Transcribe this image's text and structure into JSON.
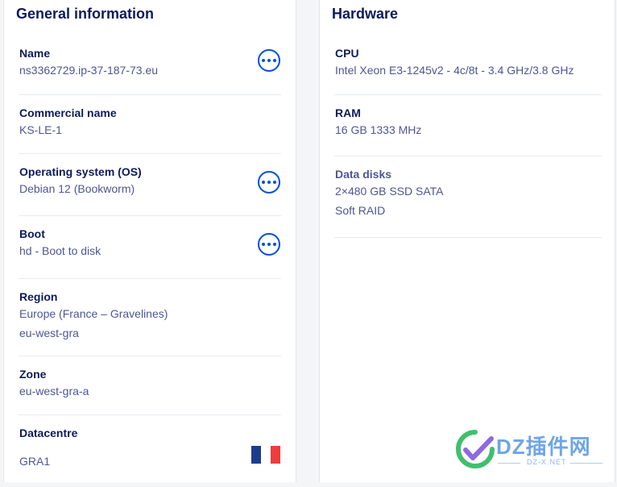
{
  "general": {
    "title": "General information",
    "name": {
      "label": "Name",
      "value": "ns3362729.ip-37-187-73.eu"
    },
    "commercial": {
      "label": "Commercial name",
      "value": "KS-LE-1"
    },
    "os": {
      "label": "Operating system (OS)",
      "value": "Debian 12 (Bookworm)"
    },
    "boot": {
      "label": "Boot",
      "value": "hd - Boot to disk"
    },
    "region": {
      "label": "Region",
      "value": "Europe (France – Gravelines)",
      "code": "eu-west-gra"
    },
    "zone": {
      "label": "Zone",
      "value": "eu-west-gra-a"
    },
    "datacentre": {
      "label": "Datacentre",
      "value": "GRA1",
      "flag_colors": [
        "#1d3c8f",
        "#ffffff",
        "#ee3d3d"
      ]
    }
  },
  "hardware": {
    "title": "Hardware",
    "cpu": {
      "label": "CPU",
      "value": "Intel Xeon E3-1245v2 - 4c/8t - 3.4 GHz/3.8 GHz"
    },
    "ram": {
      "label": "RAM",
      "value": "16 GB 1333 MHz"
    },
    "disks": {
      "label": "Data disks",
      "value": "2×480 GB SSD SATA",
      "raid": "Soft RAID"
    }
  },
  "watermark": {
    "text": "DZ插件网",
    "sub": "DZ-X.NET"
  },
  "colors": {
    "accent": "#0050d7",
    "heading": "#0d1b5b",
    "text": "#4d5693"
  }
}
